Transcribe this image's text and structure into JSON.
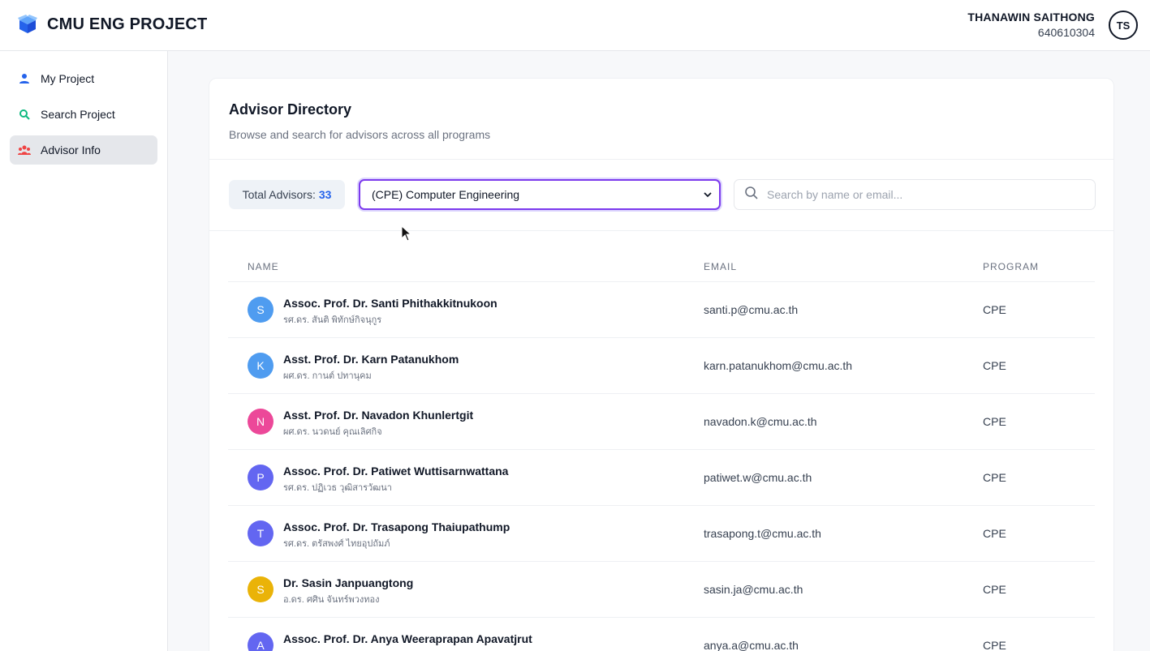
{
  "app": {
    "title": "CMU ENG PROJECT",
    "brand_color": "#2563eb"
  },
  "user": {
    "name": "THANAWIN SAITHONG",
    "id": "640610304",
    "initials": "TS"
  },
  "sidebar": {
    "items": [
      {
        "label": "My Project",
        "icon": "person-icon",
        "active": false
      },
      {
        "label": "Search Project",
        "icon": "search-icon",
        "active": false
      },
      {
        "label": "Advisor Info",
        "icon": "people-icon",
        "active": true
      }
    ]
  },
  "directory": {
    "title": "Advisor Directory",
    "subtitle": "Browse and search for advisors across all programs",
    "total_label": "Total Advisors:",
    "total_count": "33",
    "program_select": "(CPE) Computer Engineering",
    "search_placeholder": "Search by name or email...",
    "columns": {
      "name": "NAME",
      "email": "EMAIL",
      "program": "PROGRAM"
    },
    "advisors": [
      {
        "initial": "S",
        "color": "#4f9cf0",
        "name": "Assoc. Prof. Dr. Santi Phithakkitnukoon",
        "thai": "รศ.ดร. สันติ พิทักษ์กิจนุกูร",
        "email": "santi.p@cmu.ac.th",
        "program": "CPE"
      },
      {
        "initial": "K",
        "color": "#4f9cf0",
        "name": "Asst. Prof. Dr. Karn Patanukhom",
        "thai": "ผศ.ดร. กานต์ ปทานุคม",
        "email": "karn.patanukhom@cmu.ac.th",
        "program": "CPE"
      },
      {
        "initial": "N",
        "color": "#ec4899",
        "name": "Asst. Prof. Dr. Navadon Khunlertgit",
        "thai": "ผศ.ดร. นวดนย์ คุณเลิศกิจ",
        "email": "navadon.k@cmu.ac.th",
        "program": "CPE"
      },
      {
        "initial": "P",
        "color": "#6366f1",
        "name": "Assoc. Prof. Dr. Patiwet Wuttisarnwattana",
        "thai": "รศ.ดร. ปฏิเวธ วุฒิสารวัฒนา",
        "email": "patiwet.w@cmu.ac.th",
        "program": "CPE"
      },
      {
        "initial": "T",
        "color": "#6366f1",
        "name": "Assoc. Prof. Dr. Trasapong Thaiupathump",
        "thai": "รศ.ดร. ตรัสพงศ์ ไทยอุปถัมภ์",
        "email": "trasapong.t@cmu.ac.th",
        "program": "CPE"
      },
      {
        "initial": "S",
        "color": "#eab308",
        "name": "Dr. Sasin Janpuangtong",
        "thai": "อ.ดร. ศศิน จันทร์พวงทอง",
        "email": "sasin.ja@cmu.ac.th",
        "program": "CPE"
      },
      {
        "initial": "A",
        "color": "#6366f1",
        "name": "Assoc. Prof. Dr. Anya Weeraprapan Apavatjrut",
        "thai": "",
        "email": "anya.a@cmu.ac.th",
        "program": "CPE"
      }
    ]
  }
}
